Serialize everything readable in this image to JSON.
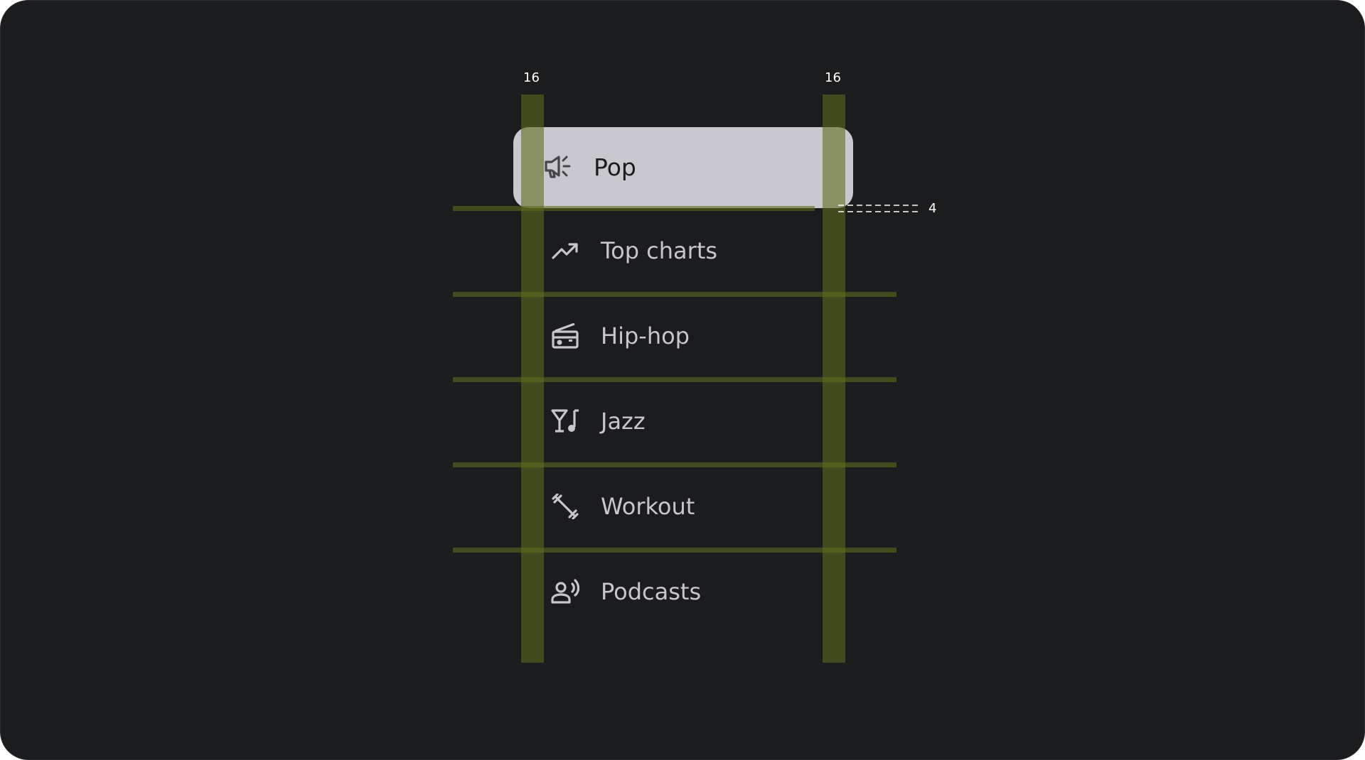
{
  "nav": {
    "items": [
      {
        "label": "Pop",
        "icon": "campaign-icon",
        "selected": true
      },
      {
        "label": "Top charts",
        "icon": "trending-up-icon",
        "selected": false
      },
      {
        "label": "Hip-hop",
        "icon": "radio-icon",
        "selected": false
      },
      {
        "label": "Jazz",
        "icon": "nightlife-icon",
        "selected": false
      },
      {
        "label": "Workout",
        "icon": "fitness-icon",
        "selected": false
      },
      {
        "label": "Podcasts",
        "icon": "record-voice-icon",
        "selected": false
      }
    ]
  },
  "annotations": {
    "left_margin": "16",
    "right_margin": "16",
    "gap": "4"
  },
  "colors": {
    "background": "#1b1c1e",
    "selected_fill": "#c9c8cf",
    "label": "#c7c6cc",
    "spec_overlay": "#5d6a1c"
  }
}
